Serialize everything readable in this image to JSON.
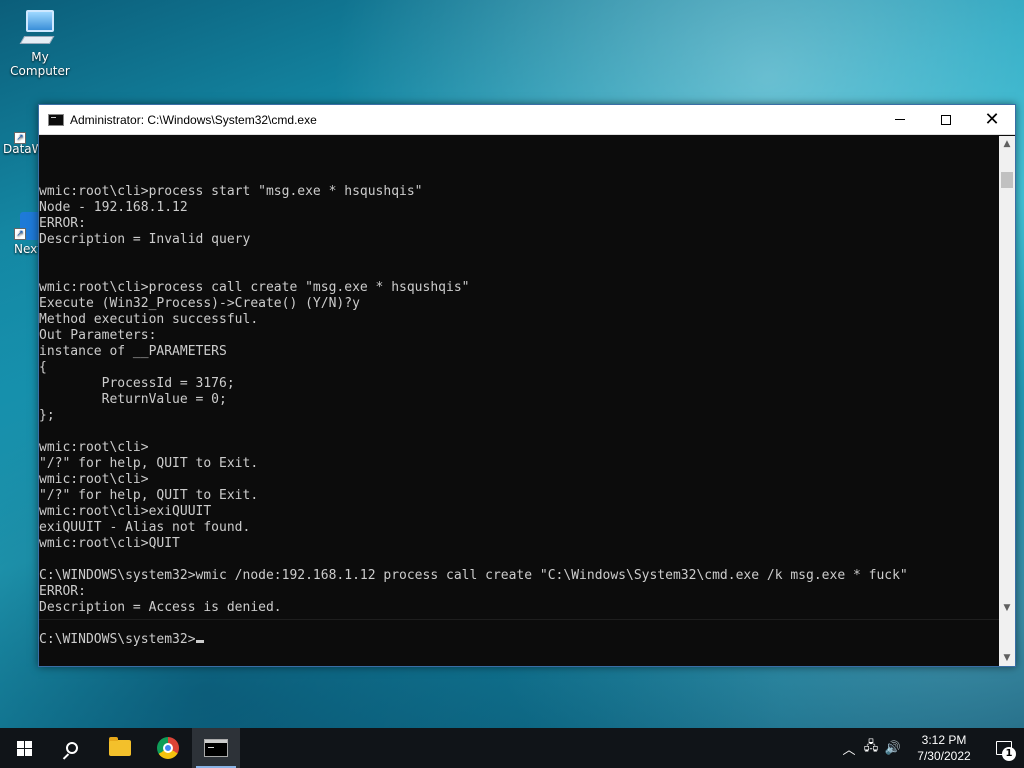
{
  "desktop": {
    "icons": [
      {
        "label": "My Computer"
      },
      {
        "label": "DataW"
      },
      {
        "label": "Next"
      }
    ]
  },
  "window": {
    "title": "Administrator: C:\\Windows\\System32\\cmd.exe",
    "console_lines": [
      "wmic:root\\cli>process start \"msg.exe * hsqushqis\"",
      "Node - 192.168.1.12",
      "ERROR:",
      "Description = Invalid query",
      "",
      "",
      "wmic:root\\cli>process call create \"msg.exe * hsqushqis\"",
      "Execute (Win32_Process)->Create() (Y/N)?y",
      "Method execution successful.",
      "Out Parameters:",
      "instance of __PARAMETERS",
      "{",
      "        ProcessId = 3176;",
      "        ReturnValue = 0;",
      "};",
      "",
      "wmic:root\\cli>",
      "\"/?\" for help, QUIT to Exit.",
      "wmic:root\\cli>",
      "\"/?\" for help, QUIT to Exit.",
      "wmic:root\\cli>exiQUUIT",
      "exiQUUIT - Alias not found.",
      "wmic:root\\cli>QUIT",
      "",
      "C:\\WINDOWS\\system32>wmic /node:192.168.1.12 process call create \"C:\\Windows\\System32\\cmd.exe /k msg.exe * fuck\"",
      "ERROR:",
      "Description = Access is denied.",
      ""
    ],
    "prompt": "C:\\WINDOWS\\system32>"
  },
  "taskbar": {
    "clock_time": "3:12 PM",
    "clock_date": "7/30/2022",
    "notification_count": "1"
  }
}
